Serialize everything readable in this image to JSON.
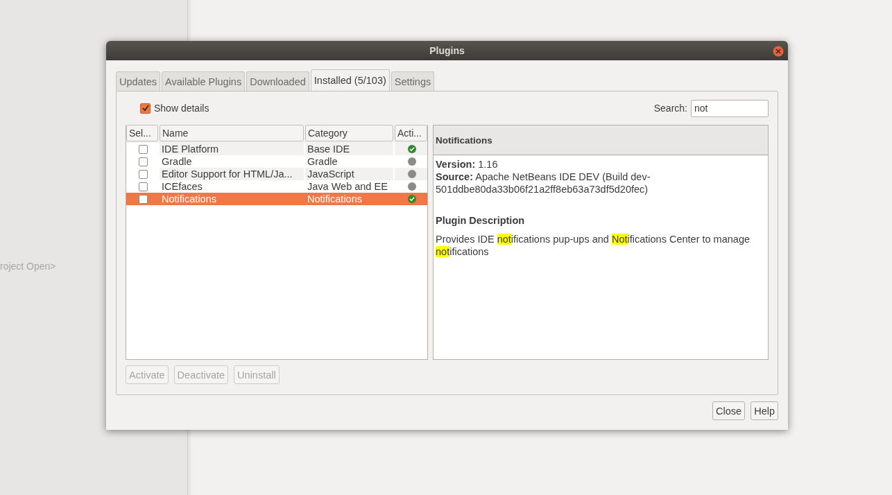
{
  "background": {
    "status_text": "roject Open>"
  },
  "window": {
    "title": "Plugins"
  },
  "tabs": [
    {
      "label": "Updates",
      "selected": false
    },
    {
      "label": "Available Plugins",
      "selected": false
    },
    {
      "label": "Downloaded",
      "selected": false
    },
    {
      "label": "Installed (5/103)",
      "selected": true
    },
    {
      "label": "Settings",
      "selected": false
    }
  ],
  "show_details": {
    "label": "Show details",
    "checked": true
  },
  "search": {
    "label": "Search:",
    "value": "not"
  },
  "table": {
    "columns": [
      "Sel...",
      "Name",
      "Category",
      "Acti..."
    ],
    "rows": [
      {
        "checked": false,
        "name": "IDE Platform",
        "category": "Base IDE",
        "active": true,
        "selected": false
      },
      {
        "checked": false,
        "name": "Gradle",
        "category": "Gradle",
        "active": false,
        "selected": false
      },
      {
        "checked": false,
        "name": "Editor Support for HTML/Ja...",
        "category": "JavaScript",
        "active": false,
        "selected": false
      },
      {
        "checked": false,
        "name": "ICEfaces",
        "category": "Java Web and EE",
        "active": false,
        "selected": false
      },
      {
        "checked": false,
        "name": "Notifications",
        "category": "Notifications",
        "active": true,
        "selected": true
      }
    ]
  },
  "details": {
    "title": "Notifications",
    "version": "**Version:** 1.16",
    "source": "**Source:** Apache NetBeans IDE DEV (Build dev-501ddbe80da33b06f21a2ff8eb63a73df5d20fec)",
    "description_heading": "Plugin Description",
    "description": [
      {
        "text": "Provides IDE ",
        "highlighted": false
      },
      {
        "text": "not",
        "highlighted": true
      },
      {
        "text": "ifications pup-ups and ",
        "highlighted": false
      },
      {
        "text": "Not",
        "highlighted": true
      },
      {
        "text": "ifications Center to manage ",
        "highlighted": false
      },
      {
        "text": "not",
        "highlighted": true
      },
      {
        "text": "ifications",
        "highlighted": false
      }
    ]
  },
  "actions": [
    {
      "label": "Activate",
      "disabled": true
    },
    {
      "label": "Deactivate",
      "disabled": true
    },
    {
      "label": "Uninstall",
      "disabled": true
    }
  ],
  "buttons": [
    {
      "label": "Close"
    },
    {
      "label": "Help"
    }
  ]
}
